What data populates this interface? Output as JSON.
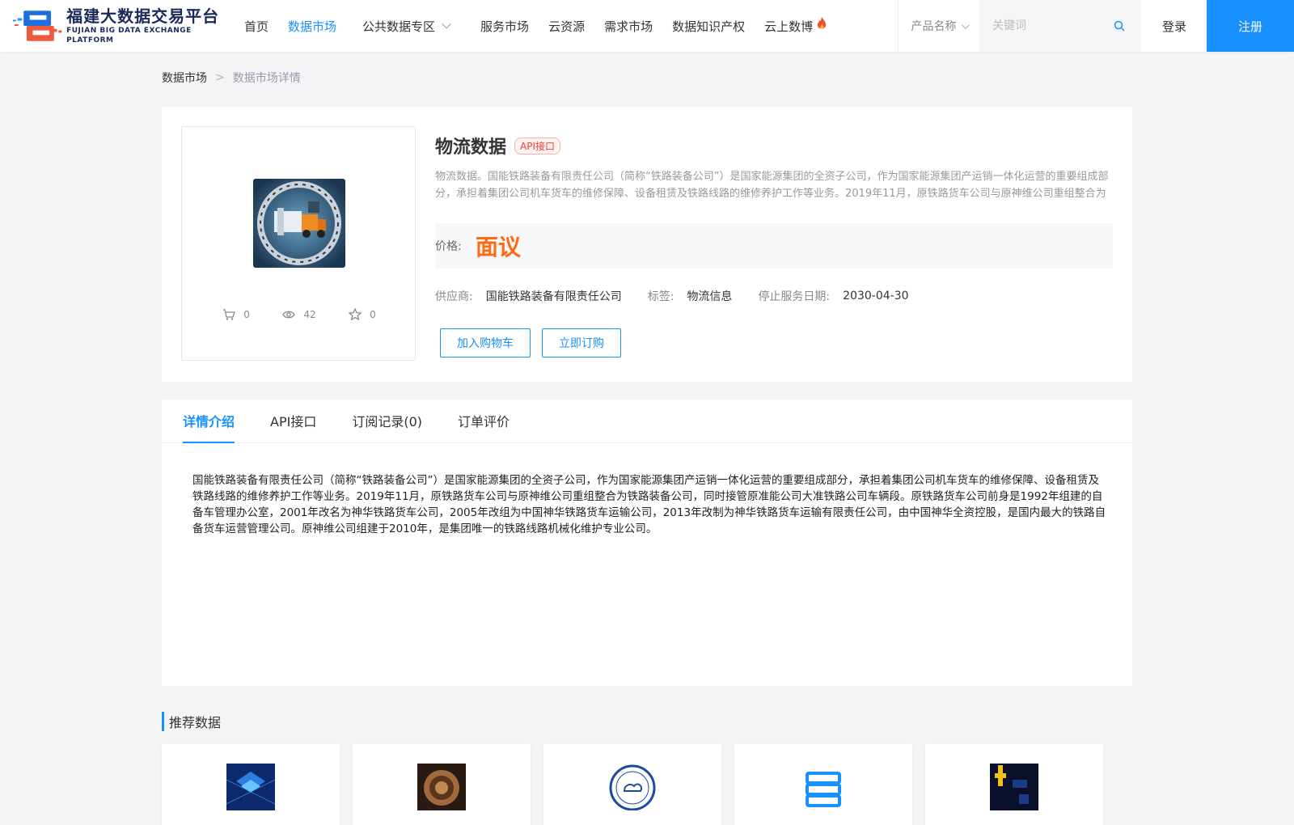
{
  "header": {
    "logo_cn": "福建大数据交易平台",
    "logo_en": "FUJIAN BIG DATA EXCHANGE  PLATFORM",
    "nav": [
      {
        "label": "首页",
        "active": false
      },
      {
        "label": "数据市场",
        "active": true
      },
      {
        "label": "公共数据专区",
        "active": false,
        "dropdown": true
      },
      {
        "label": "服务市场",
        "active": false
      },
      {
        "label": "云资源",
        "active": false
      },
      {
        "label": "需求市场",
        "active": false
      },
      {
        "label": "数据知识产权",
        "active": false
      },
      {
        "label": "云上数博",
        "active": false,
        "icon": "fire-icon"
      }
    ],
    "search_type": "产品名称",
    "search_placeholder": "关键词",
    "login": "登录",
    "register": "注册"
  },
  "breadcrumb": {
    "home": "数据市场",
    "separator": ">",
    "current": "数据市场详情"
  },
  "product": {
    "title": "物流数据",
    "badge": "API接口",
    "description": "物流数据。国能铁路装备有限责任公司（简称“铁路装备公司”）是国家能源集团的全资子公司，作为国家能源集团产运销一体化运营的重要组成部分，承担着集团公司机车货车的维修保障、设备租赁及铁路线路的维修养护工作等业务。2019年11月，原铁路货车公司与原神维公司重组整合为铁路装备公司，同时接管原准能公司大准铁路公司车辆段。",
    "price_label": "价格:",
    "price_value": "面议",
    "supplier_label": "供应商:",
    "supplier": "国能铁路装备有限责任公司",
    "tag_label": "标签:",
    "tag": "物流信息",
    "end_date_label": "停止服务日期:",
    "end_date": "2030-04-30",
    "add_cart": "加入购物车",
    "subscribe": "立即订购",
    "stats": {
      "cart": "0",
      "views": "42",
      "favorites": "0"
    }
  },
  "tabs": [
    {
      "label": "详情介绍",
      "active": true
    },
    {
      "label": "API接口",
      "active": false
    },
    {
      "label": "订阅记录(0)",
      "active": false
    },
    {
      "label": "订单评价",
      "active": false
    }
  ],
  "detail_text": "国能铁路装备有限责任公司（简称“铁路装备公司”）是国家能源集团的全资子公司，作为国家能源集团产运销一体化运营的重要组成部分，承担着集团公司机车货车的维修保障、设备租赁及铁路线路的维修养护工作等业务。2019年11月，原铁路货车公司与原神维公司重组整合为铁路装备公司，同时接管原准能公司大准铁路公司车辆段。原铁路货车公司前身是1992年组建的自备车管理办公室，2001年改名为神华铁路货车公司，2005年改组为中国神华铁路货车运输公司，2013年改制为神华铁路货车运输有限责任公司，由中国神华全资控股，是国内最大的铁路自备货车运营管理公司。原神维公司组建于2010年，是集团唯一的铁路线路机械化维护专业公司。",
  "recommend": {
    "title": "推荐数据",
    "items": [
      {
        "icon": "chip-cube-image"
      },
      {
        "icon": "bronze-coin-image"
      },
      {
        "icon": "weather-bureau-seal-image"
      },
      {
        "icon": "database-server-icon"
      },
      {
        "icon": "dark-chart-image"
      }
    ]
  },
  "colors": {
    "accent": "#1890ff",
    "price": "#ff6a13",
    "badge_red": "#e8433a"
  }
}
